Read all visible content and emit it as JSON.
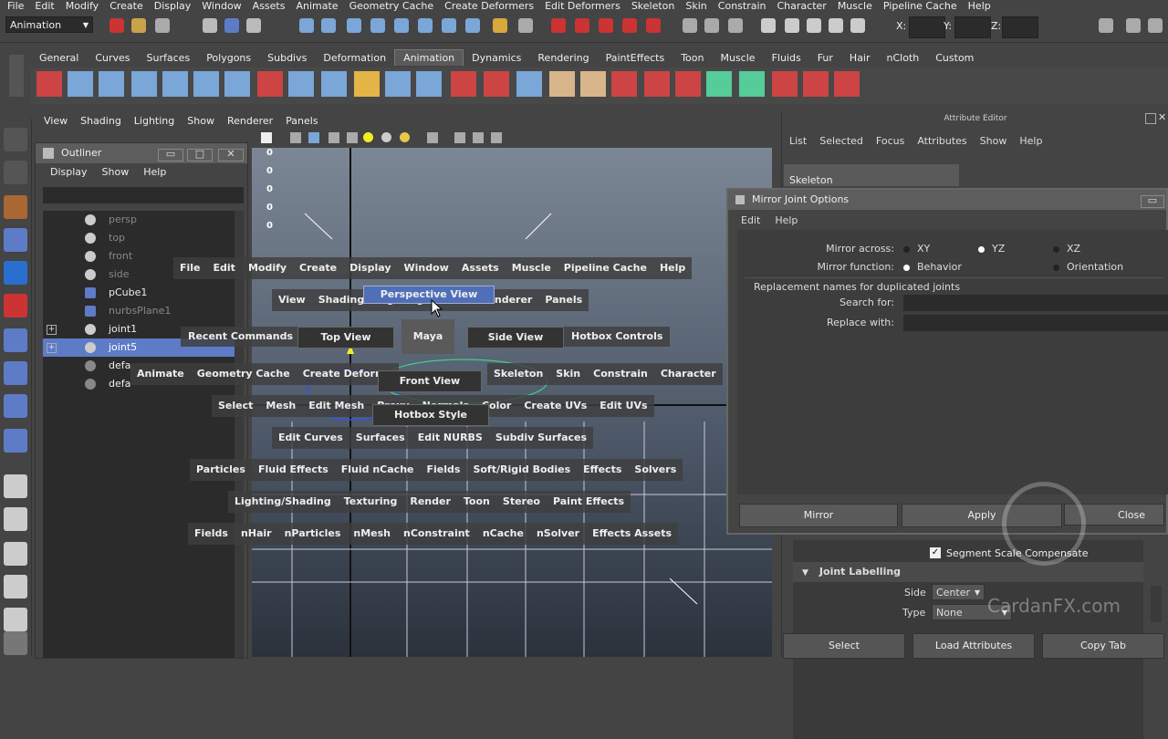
{
  "menubar": {
    "items": [
      "File",
      "Edit",
      "Modify",
      "Create",
      "Display",
      "Window",
      "Assets",
      "Animate",
      "Geometry Cache",
      "Create Deformers",
      "Edit Deformers",
      "Skeleton",
      "Skin",
      "Constrain",
      "Character",
      "Muscle",
      "Pipeline Cache",
      "Help"
    ]
  },
  "status_line": {
    "mode": "Animation",
    "x_label": "X:",
    "y_label": "Y:",
    "z_label": "Z:"
  },
  "shelf": {
    "tabs": [
      "General",
      "Curves",
      "Surfaces",
      "Polygons",
      "Subdivs",
      "Deformation",
      "Animation",
      "Dynamics",
      "Rendering",
      "PaintEffects",
      "Toon",
      "Muscle",
      "Fluids",
      "Fur",
      "Hair",
      "nCloth",
      "Custom"
    ],
    "active": "Animation"
  },
  "viewport": {
    "menu": [
      "View",
      "Shading",
      "Lighting",
      "Show",
      "Renderer",
      "Panels"
    ],
    "axis_values": [
      "0",
      "0",
      "0",
      "0",
      "0"
    ]
  },
  "outliner": {
    "title": "Outliner",
    "menu": [
      "Display",
      "Show",
      "Help"
    ],
    "items": [
      {
        "label": "persp",
        "dim": true
      },
      {
        "label": "top",
        "dim": true
      },
      {
        "label": "front",
        "dim": true
      },
      {
        "label": "side",
        "dim": true
      },
      {
        "label": "pCube1",
        "dim": false
      },
      {
        "label": "nurbsPlane1",
        "dim": true
      },
      {
        "label": "joint1",
        "dim": false
      },
      {
        "label": "joint5",
        "dim": false,
        "selected": true
      },
      {
        "label": "defaultLightSet",
        "dim": false
      },
      {
        "label": "defaultObjectSet",
        "dim": false
      }
    ],
    "item_labels": {
      "persp": "persp",
      "top": "top",
      "front": "front",
      "side": "side",
      "pcube": "pCube1",
      "nurbs": "nurbsPlane1",
      "joint1": "joint1",
      "joint5": "joint5",
      "lightset": "defa",
      "objset": "defa"
    }
  },
  "hotbox": {
    "row1": [
      "File",
      "Edit",
      "Modify",
      "Create",
      "Display",
      "Window",
      "Assets",
      "Muscle",
      "Pipeline Cache",
      "Help"
    ],
    "row2": [
      "View",
      "Shading",
      "Lighting",
      "Show",
      "Renderer",
      "Panels"
    ],
    "perspective": "Perspective View",
    "recent": "Recent Commands",
    "top_view": "Top View",
    "maya": "Maya",
    "side_view": "Side View",
    "hotbox_controls": "Hotbox Controls",
    "row4": [
      "Animate",
      "Geometry Cache",
      "Create Deforme"
    ],
    "front_view": "Front View",
    "row4b": [
      "Skeleton",
      "Skin",
      "Constrain",
      "Character"
    ],
    "row5": [
      "Select",
      "Mesh",
      "Edit Mesh",
      "Proxy",
      "Normals",
      "Color",
      "Create UVs",
      "Edit UVs"
    ],
    "hotbox_style": "Hotbox Style",
    "row6": [
      "Edit Curves",
      "Surfaces",
      "Edit NURBS",
      "Subdiv Surfaces"
    ],
    "row7": [
      "Particles",
      "Fluid Effects",
      "Fluid nCache",
      "Fields",
      "Soft/Rigid Bodies",
      "Effects",
      "Solvers"
    ],
    "row8": [
      "Lighting/Shading",
      "Texturing",
      "Render",
      "Toon",
      "Stereo",
      "Paint Effects"
    ],
    "row9": [
      "Fields",
      "nHair",
      "nParticles",
      "nMesh",
      "nConstraint",
      "nCache",
      "nSolver",
      "Effects Assets"
    ]
  },
  "attribute_editor": {
    "title": "Attribute Editor",
    "menu": [
      "List",
      "Selected",
      "Focus",
      "Attributes",
      "Show",
      "Help"
    ],
    "tab": "Skeleton",
    "segment_scale": "Segment Scale Compensate",
    "joint_labelling": "Joint Labelling",
    "side_label": "Side",
    "side_value": "Center",
    "type_label": "Type",
    "type_value": "None",
    "buttons": [
      "Select",
      "Load Attributes",
      "Copy Tab"
    ]
  },
  "mirror_dialog": {
    "title": "Mirror Joint Options",
    "menu": [
      "Edit",
      "Help"
    ],
    "mirror_across_label": "Mirror across:",
    "across_options": [
      "XY",
      "YZ",
      "XZ"
    ],
    "across_selected": "YZ",
    "mirror_function_label": "Mirror function:",
    "function_options": [
      "Behavior",
      "Orientation"
    ],
    "function_selected": "Behavior",
    "replacement_label": "Replacement names for duplicated joints",
    "search_label": "Search for:",
    "replace_label": "Replace with:",
    "buttons": [
      "Mirror",
      "Apply",
      "Close"
    ]
  },
  "watermark": "CardanFX.com",
  "colors": {
    "viewport_top": "#7c8796",
    "selection": "#5d7bc7",
    "highlight": "#4f6fb8"
  }
}
